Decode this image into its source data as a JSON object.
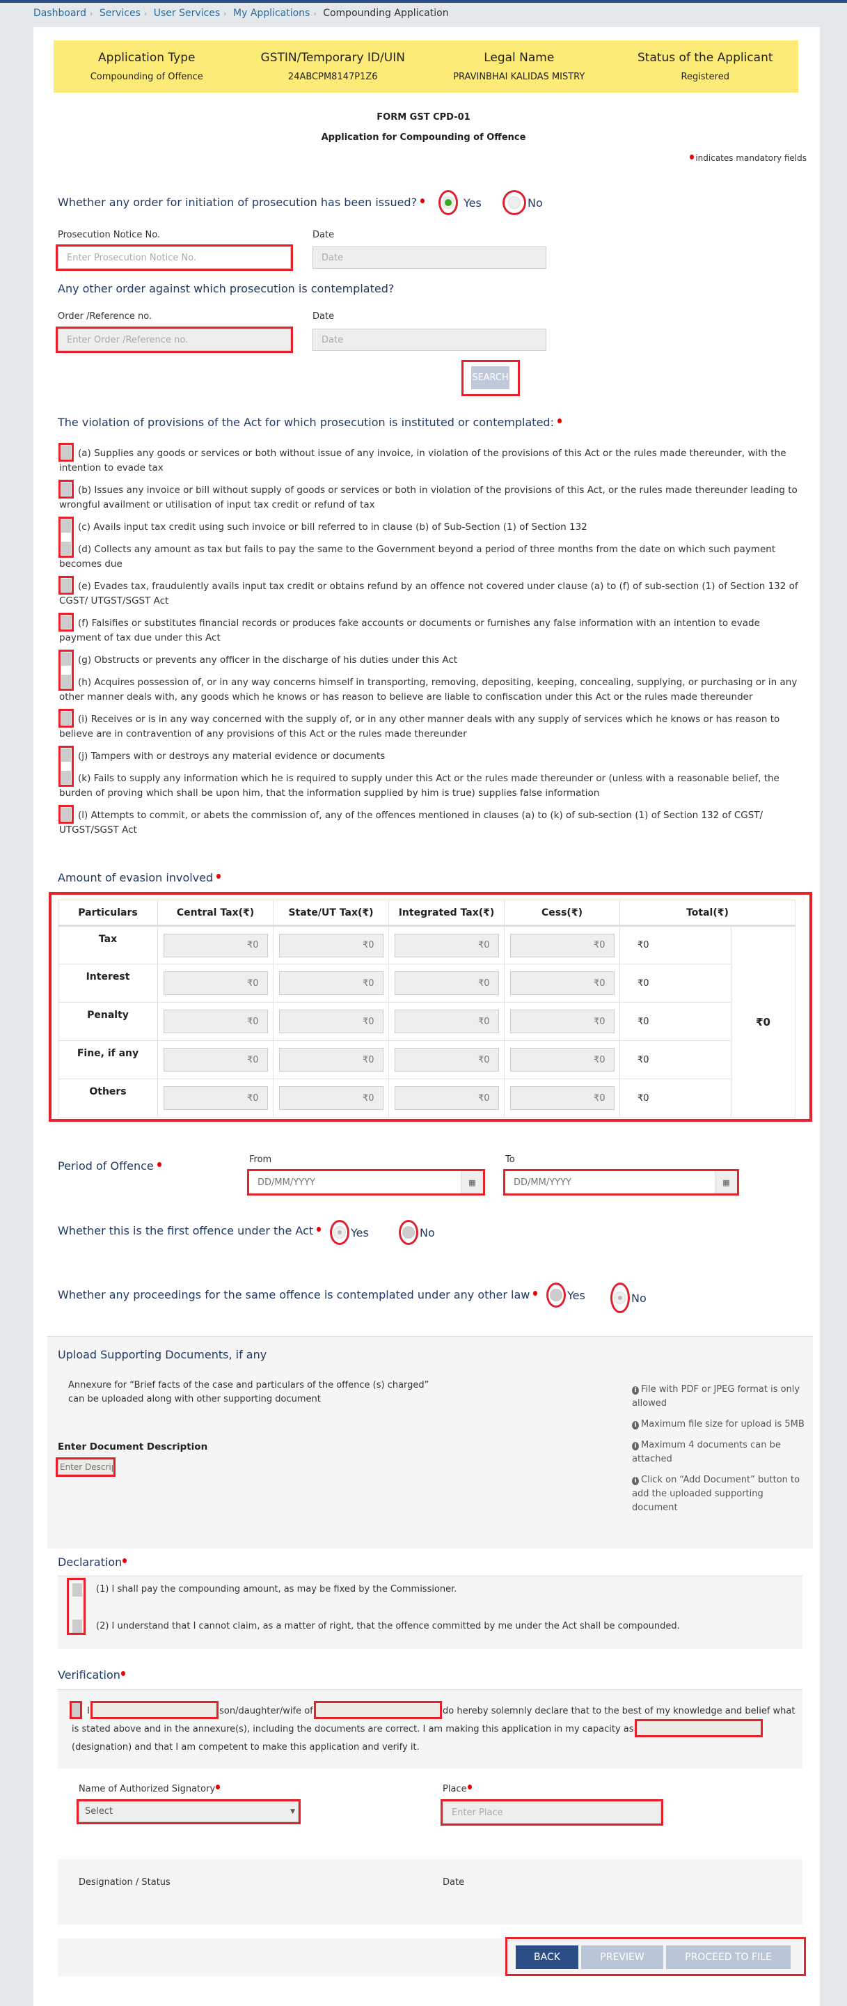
{
  "breadcrumb": {
    "items": [
      "Dashboard",
      "Services",
      "User Services",
      "My Applications"
    ],
    "current": "Compounding Application"
  },
  "info_band": {
    "columns": [
      {
        "header": "Application Type",
        "value": "Compounding of Offence"
      },
      {
        "header": "GSTIN/Temporary ID/UIN",
        "value": "24ABCPM8147P1Z6"
      },
      {
        "header": "Legal Name",
        "value": "PRAVINBHAI KALIDAS MISTRY"
      },
      {
        "header": "Status of the Applicant",
        "value": "Registered"
      }
    ]
  },
  "form": {
    "code": "FORM GST CPD-01",
    "title": "Application for Compounding of Offence",
    "mandatory_note": "indicates mandatory fields"
  },
  "prosecution": {
    "question": "Whether any order for initiation of prosecution has been issued?",
    "yes_label": "Yes",
    "no_label": "No",
    "selected": "Yes",
    "notice_label": "Prosecution Notice No.",
    "notice_placeholder": "Enter Prosecution Notice No.",
    "date_label": "Date",
    "date_placeholder": "Date"
  },
  "other_order": {
    "question": "Any other order against which prosecution is contemplated?",
    "ref_label": "Order /Reference no.",
    "ref_placeholder": "Enter Order /Reference no.",
    "date_label": "Date",
    "date_placeholder": "Date",
    "search_label": "SEARCH"
  },
  "violations": {
    "title": "The violation of provisions of the Act for which prosecution is instituted or contemplated:",
    "items": [
      "(a) Supplies any goods or services or both without issue of any invoice, in violation of the provisions of this Act or the rules made thereunder, with the intention to evade tax",
      "(b) Issues any invoice or bill without supply of goods or services or both in violation of the provisions of this Act, or the rules made thereunder leading to wrongful availment or utilisation of input tax credit or refund of tax",
      "(c) Avails input tax credit using such invoice or bill referred to in clause (b) of Sub-Section (1) of Section 132",
      "(d) Collects any amount as tax but fails to pay the same to the Government beyond a period of three months from the date on which such payment becomes due",
      "(e) Evades tax, fraudulently avails input tax credit or obtains refund by an offence not covered under clause (a) to (f) of sub-section (1) of Section 132 of CGST/ UTGST/SGST Act",
      "(f) Falsifies or substitutes financial records or produces fake accounts or documents or furnishes any false information with an intention to evade payment of tax due under this Act",
      "(g) Obstructs or prevents any officer in the discharge of his duties under this Act",
      "(h) Acquires possession of, or in any way concerns himself in transporting, removing, depositing, keeping, concealing, supplying, or purchasing or in any other manner deals with, any goods which he knows or has reason to believe are liable to confiscation under this Act or the rules made thereunder",
      "(i) Receives or is in any way concerned with the supply of, or in any other manner deals with any supply of services which he knows or has reason to believe are in contravention of any provisions of this Act or the rules made thereunder",
      "(j) Tampers with or destroys any material evidence or documents",
      "(k) Fails to supply any information which he is required to supply under this Act or the rules made thereunder or (unless with a reasonable belief, the burden of proving which shall be upon him, that the information supplied by him is true) supplies false information",
      "(l) Attempts to commit, or abets the commission of, any of the offences mentioned in clauses (a) to (k) of sub-section (1) of Section 132 of CGST/ UTGST/SGST Act"
    ]
  },
  "evasion": {
    "title": "Amount of evasion involved",
    "headers": [
      "Particulars",
      "Central Tax(₹)",
      "State/UT Tax(₹)",
      "Integrated Tax(₹)",
      "Cess(₹)",
      "Total(₹)"
    ],
    "rows": [
      {
        "particular": "Tax",
        "central": "₹0",
        "state": "₹0",
        "integrated": "₹0",
        "cess": "₹0",
        "total": "₹0"
      },
      {
        "particular": "Interest",
        "central": "₹0",
        "state": "₹0",
        "integrated": "₹0",
        "cess": "₹0",
        "total": "₹0"
      },
      {
        "particular": "Penalty",
        "central": "₹0",
        "state": "₹0",
        "integrated": "₹0",
        "cess": "₹0",
        "total": "₹0"
      },
      {
        "particular": "Fine, if any",
        "central": "₹0",
        "state": "₹0",
        "integrated": "₹0",
        "cess": "₹0",
        "total": "₹0"
      },
      {
        "particular": "Others",
        "central": "₹0",
        "state": "₹0",
        "integrated": "₹0",
        "cess": "₹0",
        "total": "₹0"
      }
    ],
    "grand_total": "₹0"
  },
  "period": {
    "label": "Period of Offence",
    "from_label": "From",
    "to_label": "To",
    "from_placeholder": "DD/MM/YYYY",
    "to_placeholder": "DD/MM/YYYY"
  },
  "first_offence": {
    "question": "Whether this is the first offence under the Act",
    "yes_label": "Yes",
    "no_label": "No"
  },
  "other_law": {
    "question": "Whether any proceedings for the same offence is contemplated under any other law",
    "yes_label": "Yes",
    "no_label": "No"
  },
  "upload": {
    "title": "Upload Supporting Documents, if any",
    "description": "Annexure for “Brief facts of the case and particulars of the offence (s) charged” can be uploaded along with other supporting document",
    "desc_label": "Enter Document Description",
    "desc_placeholder": "Enter Description",
    "notes": [
      "File with PDF or JPEG format is only allowed",
      "Maximum file size for upload is 5MB",
      "Maximum 4 documents can be attached",
      "Click on “Add Document” button to add the uploaded supporting document"
    ]
  },
  "declaration": {
    "title": "Declaration",
    "items": [
      "(1) I shall pay the compounding amount, as may be fixed by the Commissioner.",
      "(2) I understand that I cannot claim, as a matter of right, that the offence committed by me under the Act shall be compounded."
    ]
  },
  "verification": {
    "title": "Verification",
    "part1": "I",
    "part2": "son/daughter/wife of",
    "part3": "do hereby solemnly declare that to the best of my knowledge and belief what is stated above and in the annexure(s), including the documents are correct. I am making this application in my capacity as",
    "part4": "(designation) and that I am competent to make this application and verify it."
  },
  "signatory": {
    "name_label": "Name of Authorized Signatory",
    "select_value": "Select",
    "place_label": "Place",
    "place_placeholder": "Enter Place",
    "designation_label": "Designation / Status",
    "date_label": "Date"
  },
  "buttons": {
    "back": "BACK",
    "preview": "PREVIEW",
    "proceed": "PROCEED TO FILE"
  }
}
